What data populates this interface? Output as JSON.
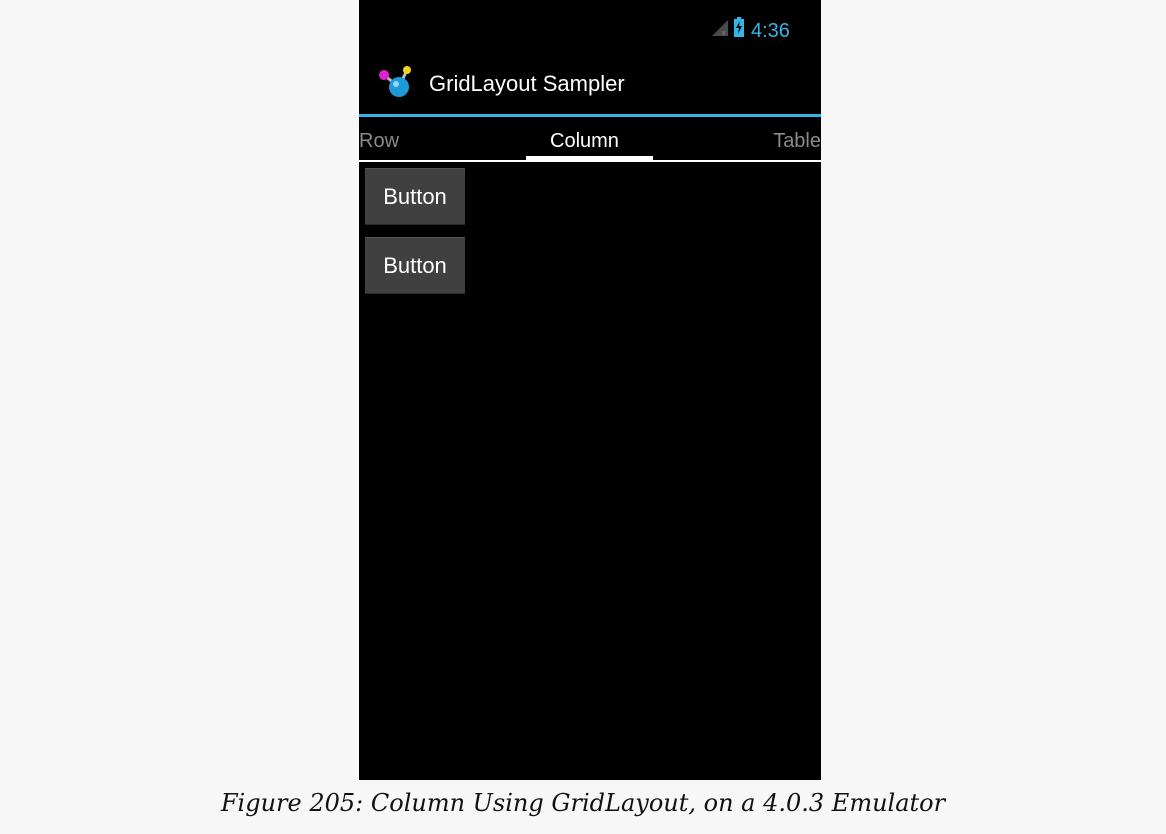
{
  "status_bar": {
    "time": "4:36",
    "time_color": "#33b5e5",
    "icons": [
      "signal-icon",
      "battery-charging-icon"
    ]
  },
  "action_bar": {
    "app_icon": "gridlayout-molecule-icon",
    "title": "GridLayout Sampler",
    "divider_color": "#33b5e5"
  },
  "tabs": [
    {
      "label": "Row",
      "selected": false
    },
    {
      "label": "Column",
      "selected": true
    },
    {
      "label": "Table",
      "selected": false
    }
  ],
  "content": {
    "buttons": [
      {
        "label": "Button"
      },
      {
        "label": "Button"
      }
    ]
  },
  "caption": "Figure 205: Column Using GridLayout, on a 4.0.3 Emulator"
}
